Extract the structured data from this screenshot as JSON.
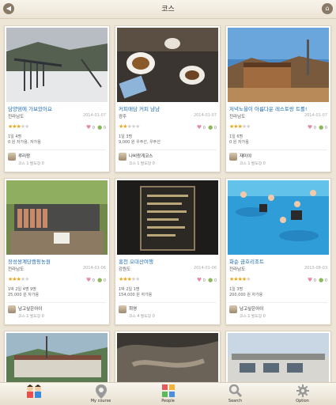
{
  "header": {
    "title": "코스"
  },
  "cards": [
    {
      "title": "담양댐에 가보았어요",
      "region": "전라남도",
      "date": "2014-01-07",
      "rating": 3,
      "likes": "0",
      "comments": "0",
      "details1": "1일    4명",
      "details2": "0 원    자가용, 자가용",
      "user": "루리랑",
      "user_stats": "코스 1    발도장 0"
    },
    {
      "title": "커피매담 커피 냠냠",
      "region": "광주",
      "date": "2014-01-07",
      "rating": 2,
      "likes": "0",
      "comments": "0",
      "details1": "1일    3명",
      "details2": "9,000 원    우주선, 우주선",
      "user": "나비랑게코스",
      "user_stats": "코스 1    발도장 0"
    },
    {
      "title": "저녁노을이 아름다운 레스토랑 트롤!",
      "region": "전라남도",
      "date": "2014-01-07",
      "rating": 3,
      "likes": "0",
      "comments": "0",
      "details1": "1일    6명",
      "details2": "0 원    자가용",
      "user": "재미야",
      "user_stats": "코스 1    발도장 0"
    },
    {
      "title": "장성쌍계당캠핑농원",
      "region": "전라남도",
      "date": "2014-01-06",
      "rating": 3,
      "likes": "0",
      "comments": "0",
      "details1": "1박 2일    4명    9명",
      "details2": "25,000 원    자가용",
      "user": "남고싶은아이",
      "user_stats": "코스 1    발도장 0"
    },
    {
      "title": "홍천 오대산여행",
      "region": "강원도",
      "date": "2014-01-06",
      "rating": 3,
      "likes": "0",
      "comments": "0",
      "details1": "1박 2일    1명",
      "details2": "154,000 원    자가용",
      "user": "최영",
      "user_stats": "코스 4    발도장 0"
    },
    {
      "title": "화순 금호리조트",
      "region": "전라남도",
      "date": "2013-08-03",
      "rating": 4,
      "likes": "0",
      "comments": "0",
      "details1": "1일    3명",
      "details2": "200,000 원    자가용",
      "user": "남고싶은아이",
      "user_stats": "코스 1    발도장 0"
    }
  ],
  "tabs": [
    {
      "label": "",
      "icon": "kids-logo-icon"
    },
    {
      "label": "My course",
      "icon": "map-pin-icon"
    },
    {
      "label": "People",
      "icon": "people-grid-icon"
    },
    {
      "label": "Search",
      "icon": "search-icon"
    },
    {
      "label": "Option",
      "icon": "gear-icon"
    }
  ],
  "colors": {
    "title_blue": "#1f6db3",
    "star_gold": "#e9a81c",
    "heart_pink": "#e58aa6",
    "comment_green": "#8ab95a"
  }
}
